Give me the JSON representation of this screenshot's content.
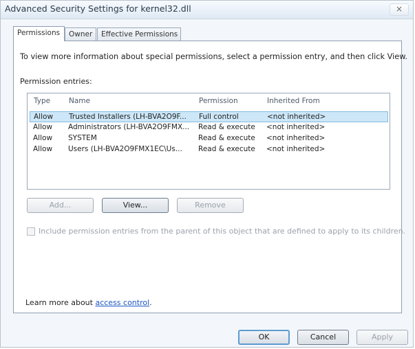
{
  "window": {
    "title": "Advanced Security Settings for kernel32.dll",
    "close_glyph": "×"
  },
  "tabs": [
    {
      "label": "Permissions",
      "active": true
    },
    {
      "label": "Owner",
      "active": false
    },
    {
      "label": "Effective Permissions",
      "active": false
    }
  ],
  "instruction": "To view more information about special permissions, select a permission entry, and then click View.",
  "entries_label": "Permission entries:",
  "table": {
    "columns": [
      "Type",
      "Name",
      "Permission",
      "Inherited From"
    ],
    "rows": [
      [
        "Allow",
        "Trusted Installers (LH-BVA2O9F...",
        "Full control",
        "<not inherited>"
      ],
      [
        "Allow",
        "Administrators (LH-BVA2O9FMX...",
        "Read & execute",
        "<not inherited>"
      ],
      [
        "Allow",
        "SYSTEM",
        "Read & execute",
        "<not inherited>"
      ],
      [
        "Allow",
        "Users (LH-BVA2O9FMX1EC\\Us...",
        "Read & execute",
        "<not inherited>"
      ]
    ],
    "selected_row": 0
  },
  "buttons": {
    "add": "Add...",
    "view": "View...",
    "remove": "Remove"
  },
  "include_inherit": {
    "label": "Include permission entries from the parent of this object that are defined to apply to its children.",
    "checked": false
  },
  "learn_more": {
    "prefix": "Learn more about ",
    "link": "access control",
    "suffix": "."
  },
  "footer": {
    "ok": "OK",
    "cancel": "Cancel",
    "apply": "Apply"
  },
  "colors": {
    "selection": "#cde7f8",
    "link": "#1a56c4",
    "default_button_border": "#5c9bd1"
  },
  "icons": [
    "close-icon"
  ]
}
